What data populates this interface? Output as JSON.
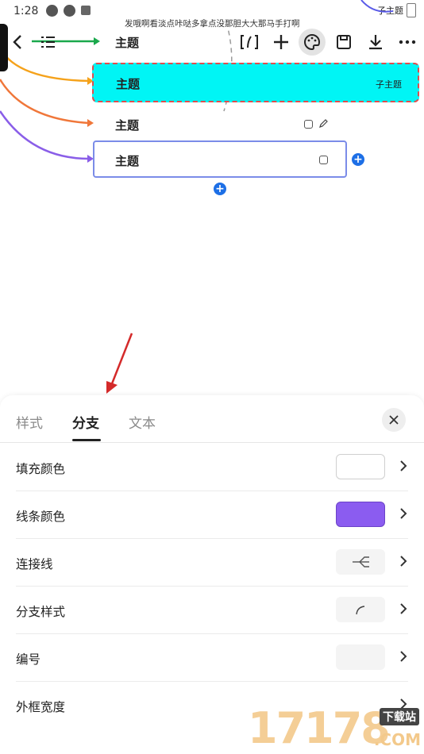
{
  "status_bar": {
    "time": "1:28",
    "right_topic": "子主题"
  },
  "floating_text": "发哦啊看淡点咔哒多拿点没那胆大大那马手打啊",
  "toolbar": {
    "icons": [
      "back-icon",
      "outline-list-icon",
      "formula-icon",
      "add-icon",
      "palette-icon",
      "save-icon",
      "download-icon",
      "more-icon"
    ]
  },
  "mindmap": {
    "nodes": [
      {
        "label": "主题"
      },
      {
        "label": "主题",
        "child_label": "子主题"
      },
      {
        "label": "主题"
      },
      {
        "label": "主题"
      }
    ],
    "colors": {
      "line1": "#1aa84c",
      "line2": "#f5a21b",
      "line3": "#f0773a",
      "line4": "#8a5ee8",
      "selected_fill": "#00f5f5",
      "selected_border": "#e04d4d",
      "editing_border": "#7b8ce8",
      "plus_button": "#1d6fe6"
    }
  },
  "sheet": {
    "tabs": [
      {
        "label": "样式",
        "active": false
      },
      {
        "label": "分支",
        "active": true
      },
      {
        "label": "文本",
        "active": false
      }
    ],
    "rows": [
      {
        "label": "填充颜色",
        "value_type": "color",
        "color": "#ffffff"
      },
      {
        "label": "线条颜色",
        "value_type": "color",
        "color": "#8b5cf0"
      },
      {
        "label": "连接线",
        "value_type": "icon",
        "icon": "connector-icon"
      },
      {
        "label": "分支样式",
        "value_type": "icon",
        "icon": "curve-icon"
      },
      {
        "label": "编号",
        "value_type": "empty"
      },
      {
        "label": "外框宽度",
        "value_type": "none"
      }
    ]
  },
  "watermark": {
    "number": "17178",
    "tag": "下载站",
    "suffix": ".COM"
  }
}
